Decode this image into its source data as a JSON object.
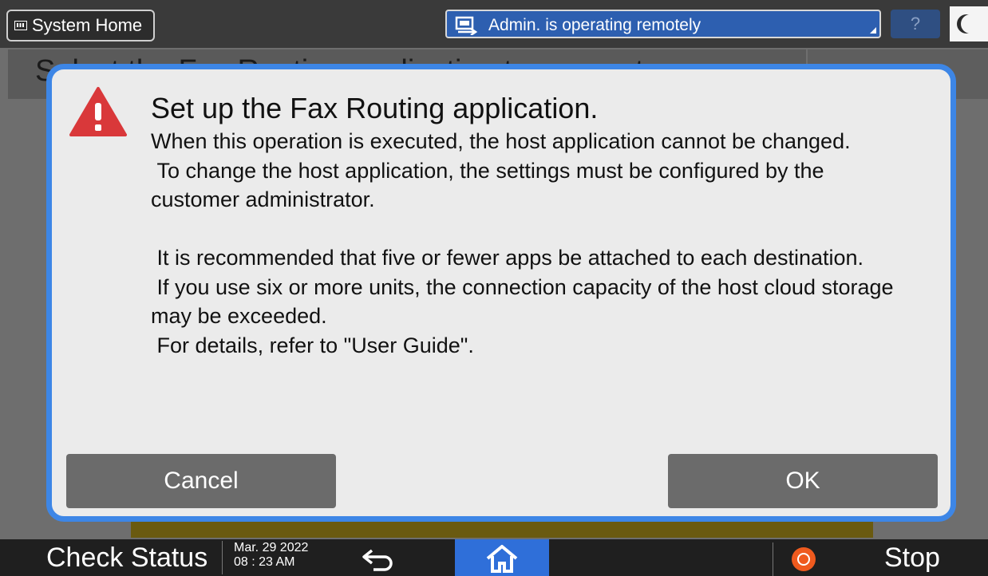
{
  "topbar": {
    "system_home_label": "System Home",
    "remote_status": "Admin. is operating remotely",
    "help_label": "?"
  },
  "background": {
    "title_fragment": "Select the Fax Routing application to connect"
  },
  "dialog": {
    "title": "Set up the Fax Routing application.",
    "body": "When this operation is executed, the host application cannot be changed.\n To change the host application, the settings must be configured by the\ncustomer administrator.\n\n It is recommended that five or fewer apps be attached to each destination.\n If you use six or more units, the connection capacity of the host cloud storage\nmay be exceeded.\n For details, refer to \"User Guide\".",
    "cancel_label": "Cancel",
    "ok_label": "OK"
  },
  "bottombar": {
    "check_status_label": "Check Status",
    "date": "Mar. 29 2022",
    "time": "08 : 23 AM",
    "stop_label": "Stop"
  },
  "colors": {
    "dialog_border": "#3d86e6",
    "warning_icon": "#d9383a",
    "home_button": "#2f6fd9",
    "stop_icon": "#ef5a1e"
  }
}
